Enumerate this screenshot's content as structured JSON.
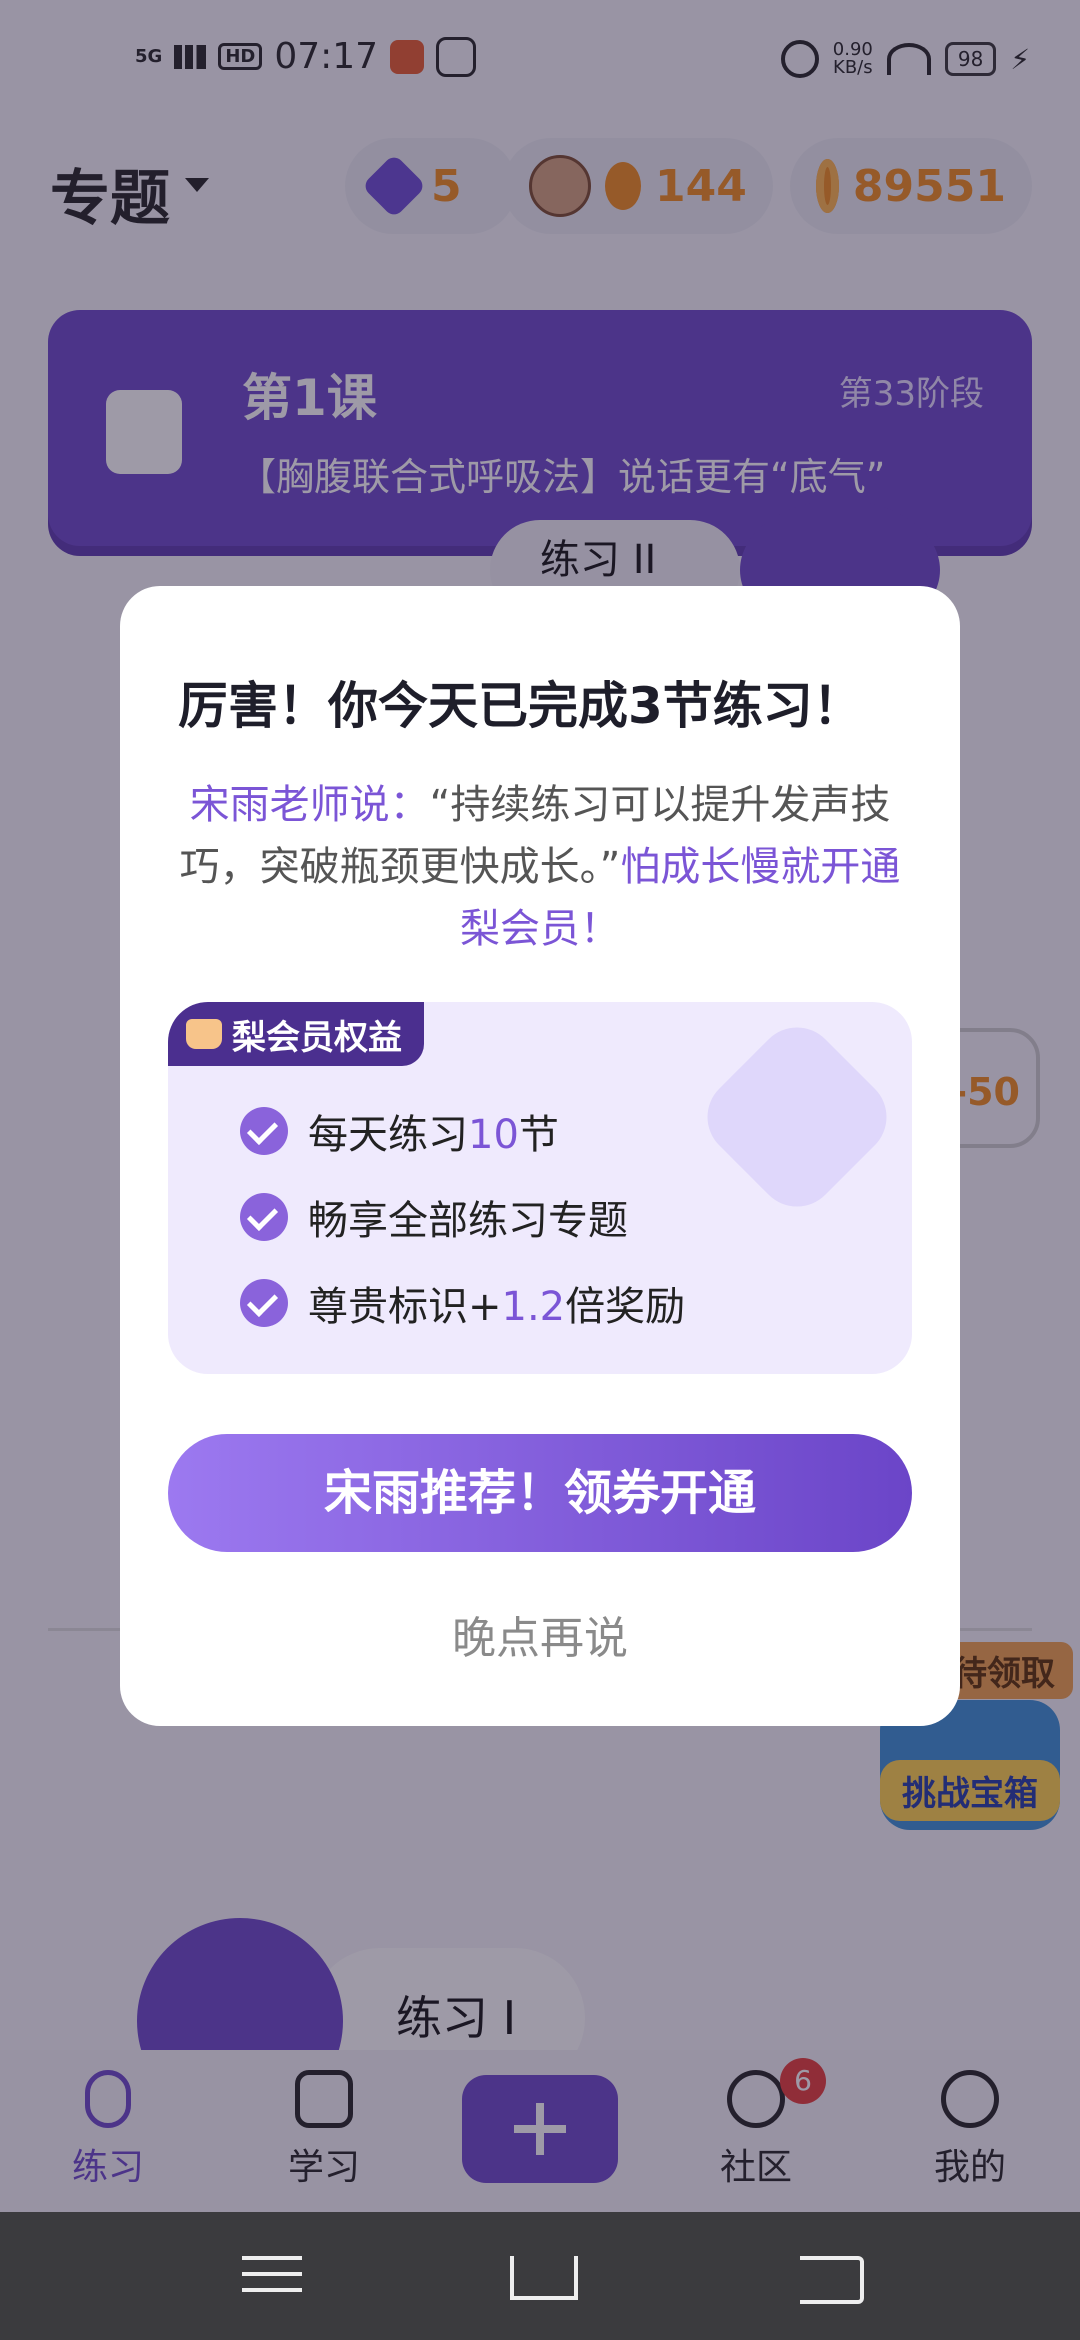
{
  "status_bar": {
    "network": "5G",
    "hd": "HD",
    "time": "07:17",
    "speed_value": "0.90",
    "speed_unit": "KB/s",
    "battery": "98"
  },
  "header": {
    "title": "专题",
    "gems": "5",
    "streak": "144",
    "coins": "89551"
  },
  "lesson": {
    "title": "第1课",
    "stage": "第33阶段",
    "subtitle": "【胸腹联合式呼吸法】说话更有“底气”"
  },
  "background": {
    "practice_two": "练习 II",
    "badge_value": "-50",
    "chest_tag": "待领取",
    "chest_label": "挑战宝箱",
    "practice_one": "练习 I"
  },
  "modal": {
    "title": "厉害！你今天已完成3节练习！",
    "msg_speaker": "宋雨老师说：",
    "msg_quote": "“持续练习可以提升发声技巧，突破瓶颈更快成长。”",
    "msg_cta": "怕成长慢就开通梨会员！",
    "benefits_title": "梨会员权益",
    "benefits": [
      {
        "pre": "每天练习",
        "num": "10",
        "post": "节"
      },
      {
        "pre": "畅享全部练习专题",
        "num": "",
        "post": ""
      },
      {
        "pre": "尊贵标识+",
        "num": "1.2",
        "post": "倍奖励"
      }
    ],
    "cta_label": "宋雨推荐！领券开通",
    "later_label": "晚点再说"
  },
  "tabs": [
    {
      "label": "练习",
      "icon": "mic-icon",
      "active": true
    },
    {
      "label": "学习",
      "icon": "play-icon"
    },
    {
      "label": "",
      "icon": "plus-icon"
    },
    {
      "label": "社区",
      "icon": "compass-icon",
      "badge": "6"
    },
    {
      "label": "我的",
      "icon": "smile-icon"
    }
  ],
  "colors": {
    "brand": "#6b45c8",
    "accent": "#7b55d6",
    "orange": "#f08a1a"
  }
}
